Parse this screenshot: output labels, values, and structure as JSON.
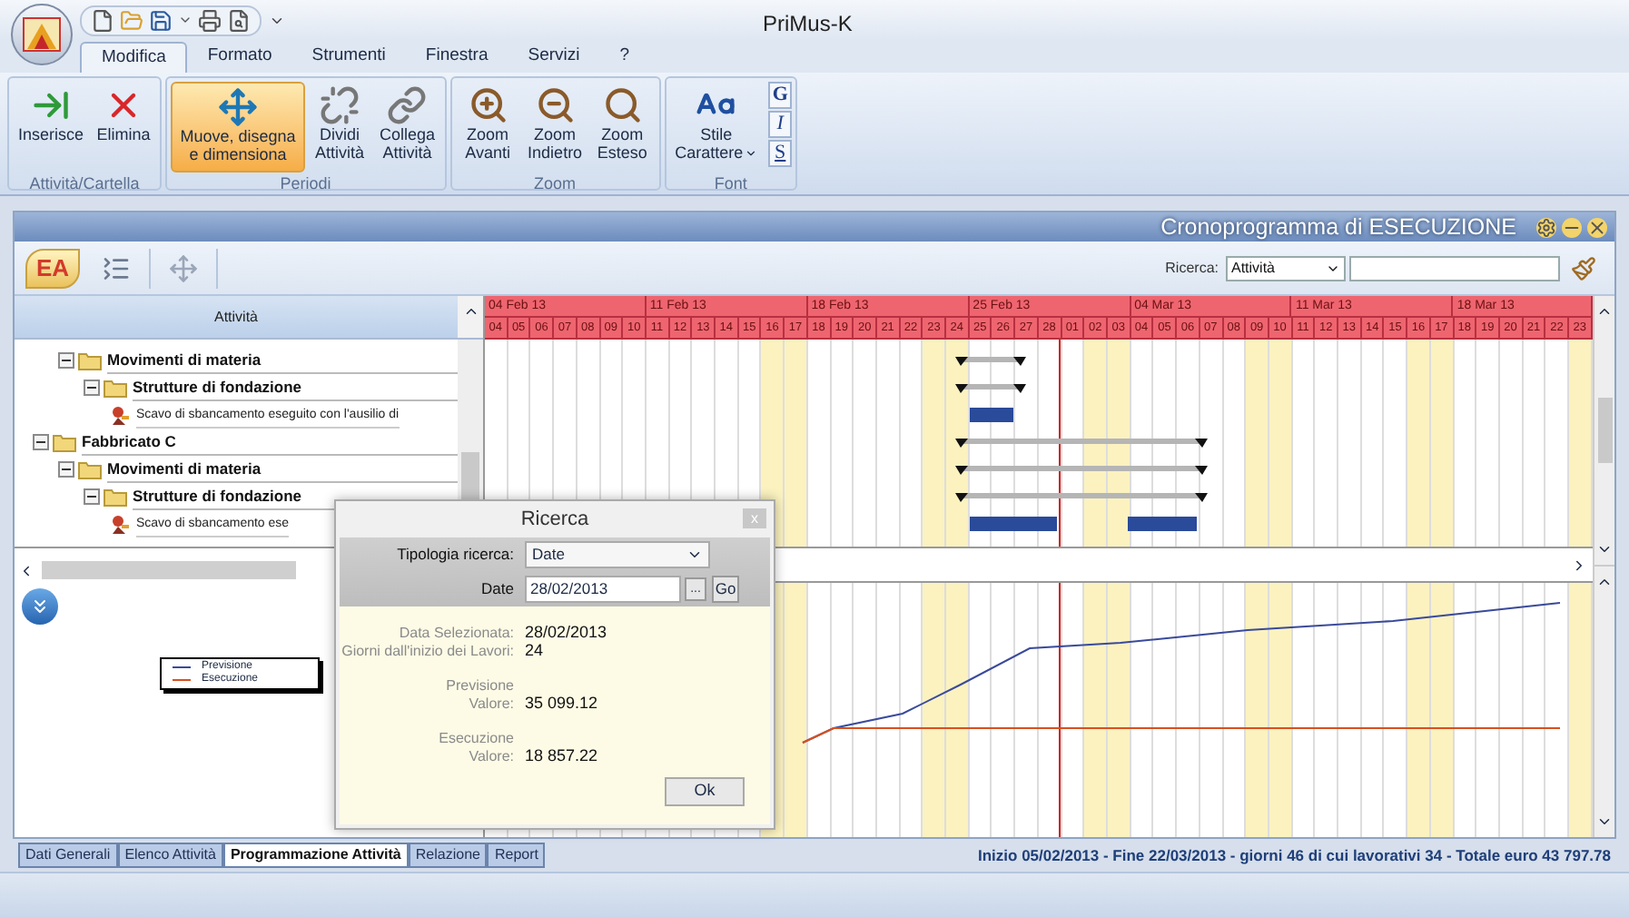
{
  "window": {
    "title": "PriMus-K"
  },
  "ribbon_tabs": [
    {
      "label": "Modifica",
      "selected": true
    },
    {
      "label": "Formato",
      "selected": false
    },
    {
      "label": "Strumenti",
      "selected": false
    },
    {
      "label": "Finestra",
      "selected": false
    },
    {
      "label": "Servizi",
      "selected": false
    },
    {
      "label": "?",
      "selected": false
    }
  ],
  "ribbon_groups": [
    {
      "label": "Attività/Cartella",
      "buttons": [
        {
          "lines": [
            "Inserisce"
          ],
          "selected": false,
          "dropdown": false
        },
        {
          "lines": [
            "Elimina"
          ],
          "selected": false,
          "dropdown": false
        }
      ]
    },
    {
      "label": "Periodi",
      "buttons": [
        {
          "lines": [
            "Muove, disegna",
            "e dimensiona"
          ],
          "selected": true,
          "dropdown": false
        },
        {
          "lines": [
            "Dividi",
            "Attività"
          ],
          "selected": false,
          "dropdown": false
        },
        {
          "lines": [
            "Collega",
            "Attività"
          ],
          "selected": false,
          "dropdown": false
        }
      ]
    },
    {
      "label": "Zoom",
      "buttons": [
        {
          "lines": [
            "Zoom",
            "Avanti"
          ],
          "selected": false,
          "dropdown": false
        },
        {
          "lines": [
            "Zoom",
            "Indietro"
          ],
          "selected": false,
          "dropdown": false
        },
        {
          "lines": [
            "Zoom",
            "Esteso"
          ],
          "selected": false,
          "dropdown": false
        }
      ]
    },
    {
      "label": "Font",
      "buttons": [
        {
          "lines": [
            "Stile",
            "Carattere"
          ],
          "selected": false,
          "dropdown": true
        }
      ],
      "format_buttons": [
        "G",
        "I",
        "S"
      ]
    }
  ],
  "panel": {
    "title": "Cronoprogramma di ESECUZIONE",
    "logo_text": "EA",
    "search_label": "Ricerca:",
    "search_type": "Attività"
  },
  "column_header": "Attività",
  "tree": [
    {
      "kind": "offscreen",
      "children": [
        {
          "kind": "folder",
          "label": "Movimenti di materia",
          "expanded": true,
          "children": [
            {
              "kind": "folder",
              "label": "Strutture di fondazione",
              "expanded": true,
              "children": [
                {
                  "kind": "task",
                  "label": "Scavo di sbancamento eseguito con l'ausilio di"
                }
              ]
            }
          ]
        }
      ]
    },
    {
      "kind": "folder",
      "label": "Fabbricato C",
      "expanded": true,
      "children": [
        {
          "kind": "folder",
          "label": "Movimenti di materia",
          "expanded": true,
          "children": [
            {
              "kind": "folder",
              "label": "Strutture di fondazione",
              "expanded": true,
              "children": [
                {
                  "kind": "task",
                  "label": "Scavo di sbancamento ese"
                }
              ]
            }
          ]
        }
      ]
    }
  ],
  "timeline": {
    "weeks": [
      "04 Feb 13",
      "11 Feb 13",
      "18 Feb 13",
      "25 Feb 13",
      "04 Mar 13",
      "11 Mar 13",
      "18 Mar 13"
    ],
    "days": [
      {
        "label": "04",
        "weekend": false,
        "selected": false
      },
      {
        "label": "05",
        "weekend": false,
        "selected": false
      },
      {
        "label": "06",
        "weekend": false,
        "selected": false
      },
      {
        "label": "07",
        "weekend": false,
        "selected": false
      },
      {
        "label": "08",
        "weekend": false,
        "selected": false
      },
      {
        "label": "09",
        "weekend": false,
        "selected": false
      },
      {
        "label": "10",
        "weekend": false,
        "selected": false
      },
      {
        "label": "11",
        "weekend": false,
        "selected": false
      },
      {
        "label": "12",
        "weekend": false,
        "selected": false
      },
      {
        "label": "13",
        "weekend": false,
        "selected": false
      },
      {
        "label": "14",
        "weekend": false,
        "selected": false
      },
      {
        "label": "15",
        "weekend": false,
        "selected": false
      },
      {
        "label": "16",
        "weekend": true,
        "selected": false
      },
      {
        "label": "17",
        "weekend": true,
        "selected": false
      },
      {
        "label": "18",
        "weekend": false,
        "selected": false
      },
      {
        "label": "19",
        "weekend": false,
        "selected": false
      },
      {
        "label": "20",
        "weekend": false,
        "selected": false
      },
      {
        "label": "21",
        "weekend": false,
        "selected": false
      },
      {
        "label": "22",
        "weekend": false,
        "selected": false
      },
      {
        "label": "23",
        "weekend": true,
        "selected": false
      },
      {
        "label": "24",
        "weekend": true,
        "selected": false
      },
      {
        "label": "25",
        "weekend": false,
        "selected": false
      },
      {
        "label": "26",
        "weekend": false,
        "selected": false
      },
      {
        "label": "27",
        "weekend": false,
        "selected": false
      },
      {
        "label": "28",
        "weekend": false,
        "selected": true
      },
      {
        "label": "01",
        "weekend": false,
        "selected": false
      },
      {
        "label": "02",
        "weekend": true,
        "selected": false
      },
      {
        "label": "03",
        "weekend": true,
        "selected": false
      },
      {
        "label": "04",
        "weekend": false,
        "selected": false
      },
      {
        "label": "05",
        "weekend": false,
        "selected": false
      },
      {
        "label": "06",
        "weekend": false,
        "selected": false
      },
      {
        "label": "07",
        "weekend": false,
        "selected": false
      },
      {
        "label": "08",
        "weekend": false,
        "selected": false
      },
      {
        "label": "09",
        "weekend": true,
        "selected": false
      },
      {
        "label": "10",
        "weekend": true,
        "selected": false
      },
      {
        "label": "11",
        "weekend": false,
        "selected": false
      },
      {
        "label": "12",
        "weekend": false,
        "selected": false
      },
      {
        "label": "13",
        "weekend": false,
        "selected": false
      },
      {
        "label": "14",
        "weekend": false,
        "selected": false
      },
      {
        "label": "15",
        "weekend": false,
        "selected": false
      },
      {
        "label": "16",
        "weekend": true,
        "selected": false
      },
      {
        "label": "17",
        "weekend": true,
        "selected": false
      },
      {
        "label": "18",
        "weekend": false,
        "selected": false
      },
      {
        "label": "19",
        "weekend": false,
        "selected": false
      },
      {
        "label": "20",
        "weekend": false,
        "selected": false
      },
      {
        "label": "21",
        "weekend": false,
        "selected": false
      },
      {
        "label": "22",
        "weekend": false,
        "selected": false
      },
      {
        "label": "23",
        "weekend": true,
        "selected": false
      }
    ]
  },
  "legend": [
    {
      "label": "Previsione",
      "color": "#3a4a9a"
    },
    {
      "label": "Esecuzione",
      "color": "#d9501e"
    }
  ],
  "dialog": {
    "title": "Ricerca",
    "close": "x",
    "fields": [
      {
        "kind": "select",
        "label": "Tipologia ricerca:",
        "value": "Date"
      },
      {
        "kind": "date",
        "label": "Date",
        "value": "28/02/2013",
        "browse": "...",
        "go": "Go"
      }
    ],
    "info": [
      {
        "kind": "pair",
        "label": "Data Selezionata:",
        "value": "28/02/2013"
      },
      {
        "kind": "pair",
        "label": "Giorni dall'inizio dei Lavori:",
        "value": "24"
      },
      {
        "kind": "heading",
        "label": "Previsione"
      },
      {
        "kind": "pair",
        "label": "Valore:",
        "value": "35 099.12"
      },
      {
        "kind": "heading",
        "label": "Esecuzione"
      },
      {
        "kind": "pair",
        "label": "Valore:",
        "value": "18 857.22"
      }
    ],
    "ok": "Ok"
  },
  "bottom_tabs": [
    {
      "label": "Dati Generali",
      "selected": false
    },
    {
      "label": "Elenco  Attività",
      "selected": false
    },
    {
      "label": "Programmazione Attività",
      "selected": true
    },
    {
      "label": "Relazione",
      "selected": false
    },
    {
      "label": "Report",
      "selected": false
    }
  ],
  "status": "Inizio 05/02/2013 - Fine 22/03/2013 - giorni 46 di cui lavorativi 34 - Totale euro 43 797.78"
}
